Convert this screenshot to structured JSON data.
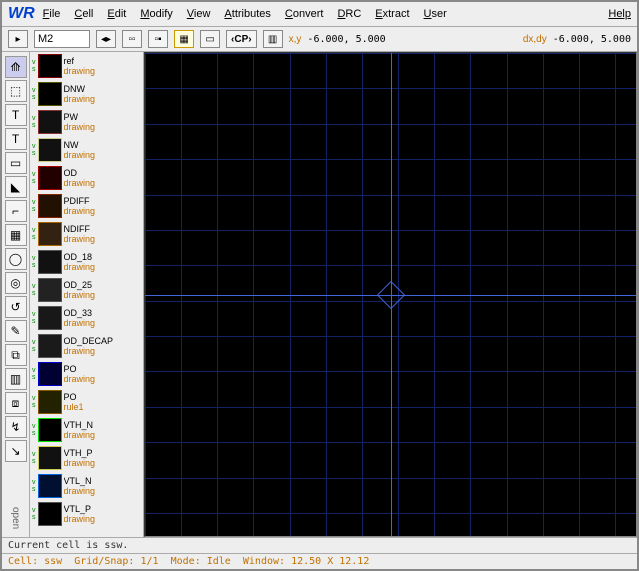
{
  "menu": [
    "File",
    "Cell",
    "Edit",
    "Modify",
    "View",
    "Attributes",
    "Convert",
    "DRC",
    "Extract",
    "User"
  ],
  "menu_help": "Help",
  "toolbar": {
    "cell_input": "M2",
    "cp_label": "CP",
    "xy_label": "x,y",
    "xy_val": "-6.000, 5.000",
    "dxy_label": "dx,dy",
    "dxy_val": "-6.000, 5.000"
  },
  "layers": [
    {
      "name": "ref",
      "sub": "drawing",
      "bg": "#000",
      "border": "#800"
    },
    {
      "name": "DNW",
      "sub": "drawing",
      "bg": "#000",
      "border": "#550"
    },
    {
      "name": "PW",
      "sub": "drawing",
      "bg": "#111",
      "border": "#833"
    },
    {
      "name": "NW",
      "sub": "drawing",
      "bg": "#111",
      "border": "#cc8"
    },
    {
      "name": "OD",
      "sub": "drawing",
      "bg": "#200",
      "border": "#a00"
    },
    {
      "name": "PDIFF",
      "sub": "drawing",
      "bg": "#210",
      "border": "#820"
    },
    {
      "name": "NDIFF",
      "sub": "drawing",
      "bg": "#321",
      "border": "#a60"
    },
    {
      "name": "OD_18",
      "sub": "drawing",
      "bg": "#111",
      "border": "#555"
    },
    {
      "name": "OD_25",
      "sub": "drawing",
      "bg": "#222",
      "border": "#555"
    },
    {
      "name": "OD_33",
      "sub": "drawing",
      "bg": "#181818",
      "border": "#555"
    },
    {
      "name": "OD_DECAP",
      "sub": "drawing",
      "bg": "#1a1a1a",
      "border": "#555"
    },
    {
      "name": "PO",
      "sub": "drawing",
      "bg": "#003",
      "border": "#00c"
    },
    {
      "name": "PO",
      "sub": "rule1",
      "bg": "#220",
      "border": "#850"
    },
    {
      "name": "VTH_N",
      "sub": "drawing",
      "bg": "#000",
      "border": "#0d0"
    },
    {
      "name": "VTH_P",
      "sub": "drawing",
      "bg": "#111",
      "border": "#cc5"
    },
    {
      "name": "VTL_N",
      "sub": "drawing",
      "bg": "#001030",
      "border": "#06d"
    },
    {
      "name": "VTL_P",
      "sub": "drawing",
      "bg": "#000",
      "border": "#555"
    }
  ],
  "tools": [
    "⟰",
    "⬚",
    "T",
    "T",
    "▭",
    "◣",
    "⌐",
    "▦",
    "◯",
    "◎",
    "↺",
    "✎",
    "⧉",
    "▥",
    "⧈",
    "↯",
    "↘"
  ],
  "open_label": "open",
  "status1": "Current cell is ssw.",
  "status2": {
    "cell": "ssw",
    "gridsnap": "1/1",
    "mode": "Idle",
    "window": "12.50 X 12.12"
  }
}
